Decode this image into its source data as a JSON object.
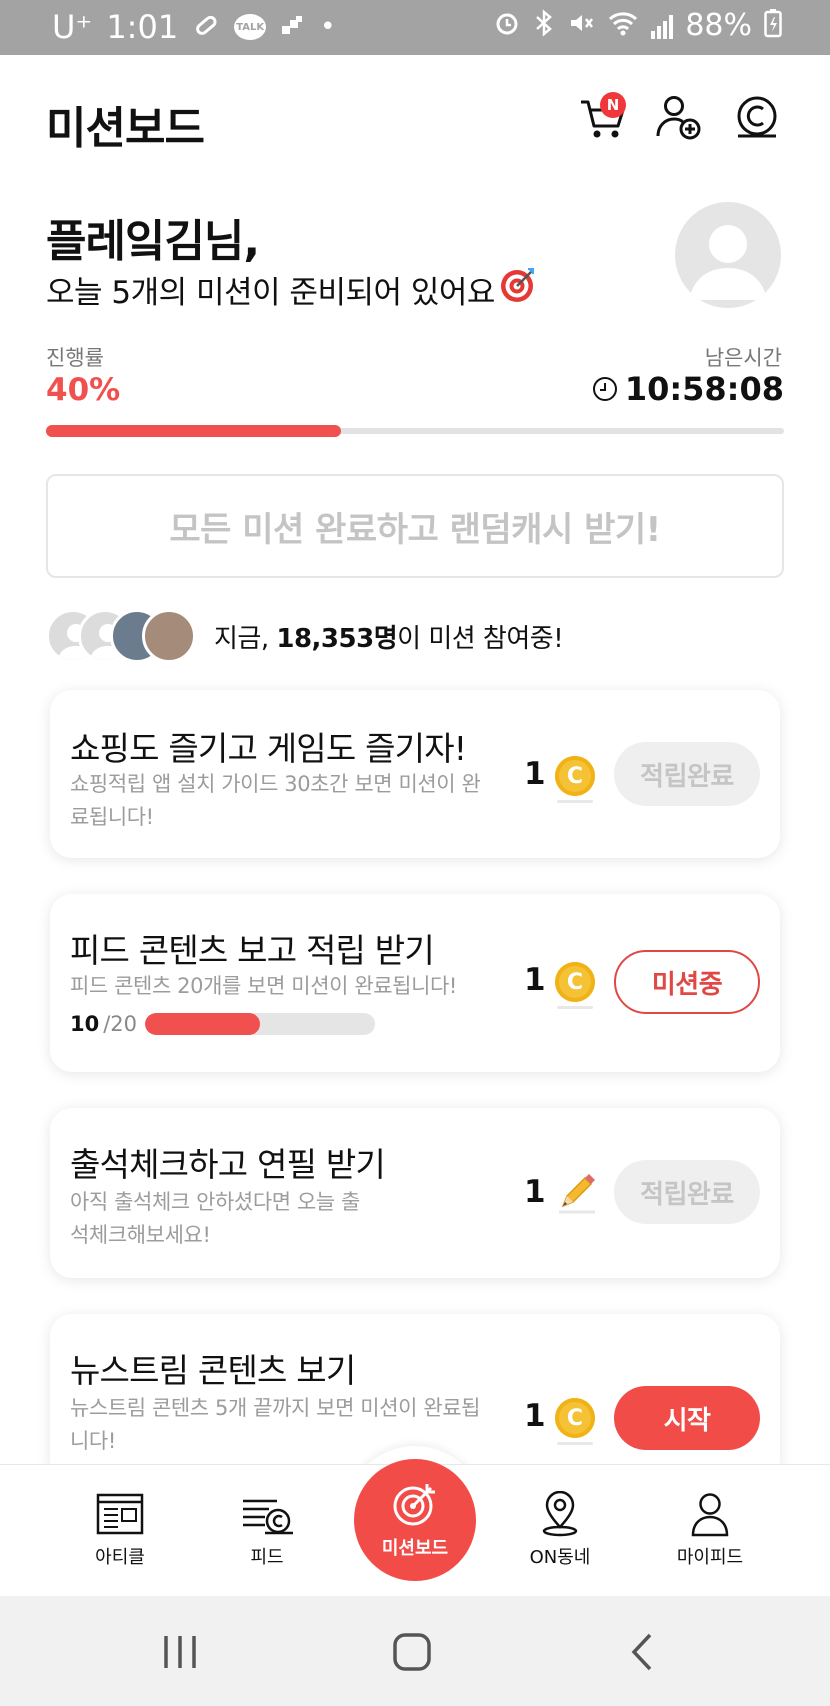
{
  "status_bar": {
    "carrier": "U⁺",
    "time": "1:01",
    "talk_label": "TALK",
    "battery": "88%"
  },
  "header": {
    "title": "미션보드",
    "cart_badge": "N"
  },
  "greeting": {
    "name": "플레잌김님,",
    "subtitle": "오늘 5개의 미션이 준비되어 있어요",
    "subtitle_emoji": "🎯"
  },
  "progress": {
    "label": "진행률",
    "value_text": "40%",
    "fraction": 0.4,
    "time_label": "남은시간",
    "time_value": "10:58:08"
  },
  "random_cash_button": "모든 미션 완료하고 랜덤캐시 받기!",
  "participants": {
    "prefix": "지금, ",
    "count": "18,353명",
    "suffix": "이 미션 참여중!"
  },
  "missions": [
    {
      "title": "쇼핑도 즐기고 게임도 즐기자!",
      "desc": "쇼핑적립 앱 설치 가이드 30초간 보면 미션이 완료됩니다!",
      "reward": "1",
      "reward_icon": "coin-icon",
      "button": "적립완료",
      "state": "done"
    },
    {
      "title": "피드 콘텐츠 보고 적립 받기",
      "desc": "피드 콘텐츠 20개를 보면 미션이 완료됩니다!",
      "reward": "1",
      "reward_icon": "coin-icon",
      "button": "미션중",
      "state": "in_progress",
      "progress_current": "10",
      "progress_total": "/20",
      "progress_fraction": 0.5
    },
    {
      "title": "출석체크하고 연필 받기",
      "desc": "아직 출석체크 안하셨다면 오늘 출석체크해보세요!",
      "reward": "1",
      "reward_icon": "pencil-icon",
      "button": "적립완료",
      "state": "done"
    },
    {
      "title": "뉴스트림 콘텐츠 보기",
      "desc": "뉴스트림 콘텐츠 5개 끝까지 보면 미션이 완료됩니다!",
      "reward": "1",
      "reward_icon": "coin-icon",
      "button": "시작",
      "state": "start"
    }
  ],
  "bottom_nav": {
    "items": [
      {
        "label": "아티클",
        "icon": "article-icon"
      },
      {
        "label": "피드",
        "icon": "feed-icon"
      },
      {
        "label": "미션보드",
        "icon": "target-icon"
      },
      {
        "label": "ON동네",
        "icon": "location-pin-icon"
      },
      {
        "label": "마이피드",
        "icon": "person-icon"
      }
    ]
  },
  "colors": {
    "accent": "#f24c49",
    "progress": "#f0514f",
    "coin": "#f5c235",
    "status_bar": "#a3a3a3"
  }
}
